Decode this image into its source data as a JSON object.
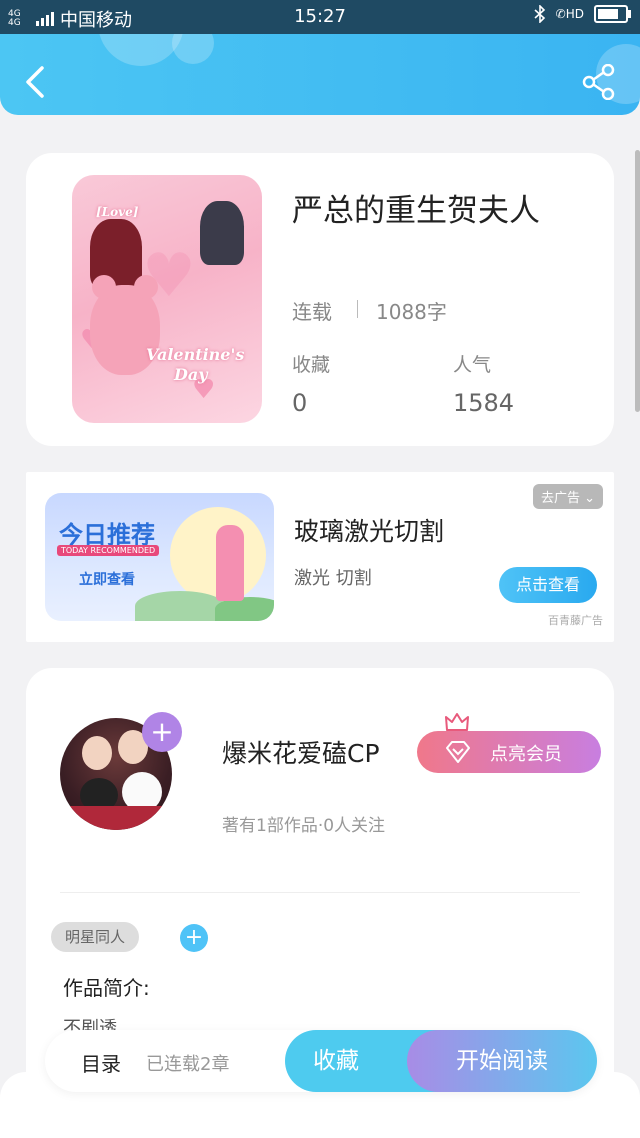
{
  "status_bar": {
    "network": "4G 4G",
    "carrier": "中国移动",
    "time": "15:27",
    "hd": "HD"
  },
  "header": {
    "back_icon": "chevron-left-icon",
    "share_icon": "share-icon"
  },
  "book": {
    "title": "严总的重生贺夫人",
    "status": "连载",
    "word_count": "1088字",
    "stats": [
      {
        "label": "收藏",
        "value": "0"
      },
      {
        "label": "人气",
        "value": "1584"
      }
    ],
    "cover_text": {
      "love": "[Love]",
      "valentine": "Valentine's",
      "day": "Day"
    }
  },
  "ad": {
    "banner_title": "今日推荐",
    "banner_sub": "TODAY RECOMMENDED",
    "banner_cta": "立即查看",
    "title": "玻璃激光切割",
    "subtitle": "激光 切割",
    "tag": "去广告",
    "button": "点击查看",
    "source": "百青藤广告"
  },
  "author": {
    "name": "爆米花爱磕CP",
    "vip_button": "点亮会员",
    "meta": "著有1部作品·0人关注",
    "follow_symbol": "+"
  },
  "tags": [
    "明星同人"
  ],
  "tag_add_symbol": "+",
  "intro": {
    "label": "作品简介:",
    "text": "不剧透"
  },
  "bottom_bar": {
    "toc": "目录",
    "toc_sub": "已连载2章",
    "collect": "收藏",
    "read": "开始阅读"
  },
  "colors": {
    "header": "#3ab4f2",
    "accent_blue": "#4ecbef",
    "vip_gradient_start": "#f0788a",
    "vip_gradient_end": "#c87ee0"
  }
}
